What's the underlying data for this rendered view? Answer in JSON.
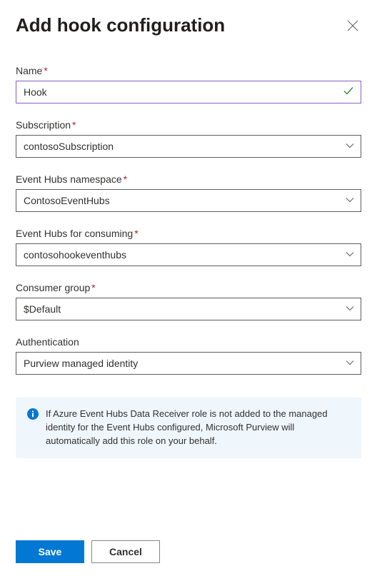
{
  "header": {
    "title": "Add hook configuration"
  },
  "form": {
    "name": {
      "label": "Name",
      "required": true,
      "value": "Hook"
    },
    "subscription": {
      "label": "Subscription",
      "required": true,
      "value": "contosoSubscription"
    },
    "namespace": {
      "label": "Event Hubs namespace",
      "required": true,
      "value": "ContosoEventHubs"
    },
    "consuming": {
      "label": "Event Hubs for consuming",
      "required": true,
      "value": "contosohookeventhubs"
    },
    "consumerGroup": {
      "label": "Consumer group",
      "required": true,
      "value": "$Default"
    },
    "authentication": {
      "label": "Authentication",
      "required": false,
      "value": "Purview managed identity"
    }
  },
  "info": {
    "text": "If Azure Event Hubs Data Receiver role is not added to the managed identity for the Event Hubs configured, Microsoft Purview will automatically add this role on your behalf."
  },
  "footer": {
    "save": "Save",
    "cancel": "Cancel"
  }
}
